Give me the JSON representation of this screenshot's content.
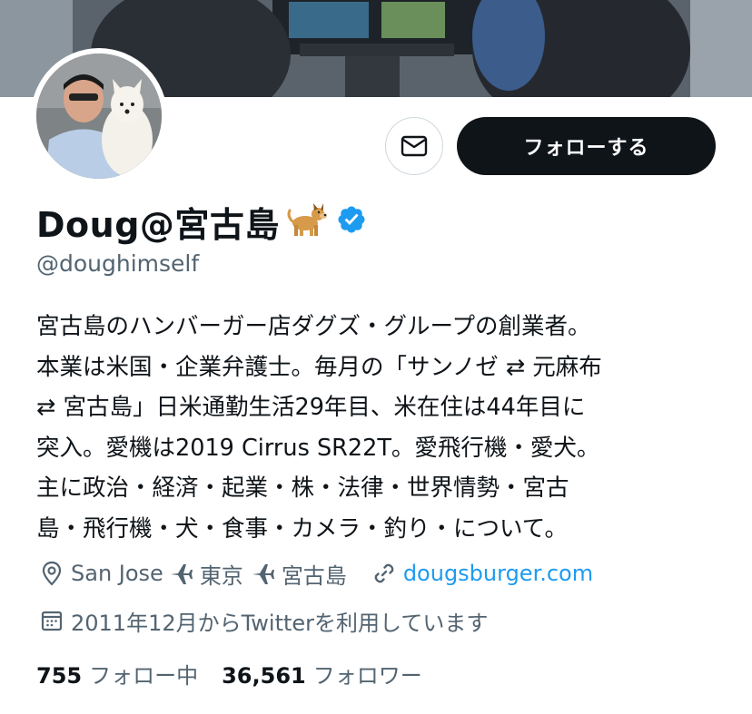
{
  "profile": {
    "display_name": "Doug@宮古島",
    "handle": "@doughimself",
    "bio": "宮古島のハンバーガー店ダグズ・グループの創業者。\n本業は米国・企業弁護士。毎月の「サンノゼ ⇄ 元麻布\n⇄ 宮古島」日米通勤生活29年目、米在住は44年目に\n突入。愛機は2019 Cirrus SR22T。愛飛行機・愛犬。\n主に政治・経済・起業・株・法律・世界情勢・宮古\n島・飛行機・犬・食事・カメラ・釣り・について。",
    "location_parts": [
      "San Jose",
      "東京",
      "宮古島"
    ],
    "url": "dougsburger.com",
    "joined": "2011年12月からTwitterを利用しています",
    "following_count": "755",
    "following_label": "フォロー中",
    "followers_count": "36,561",
    "followers_label": "フォロワー"
  },
  "actions": {
    "follow_label": "フォローする"
  },
  "icons": {
    "message": "mail-icon",
    "verified": "verified-badge-icon",
    "location": "location-pin-icon",
    "plane": "airplane-icon",
    "link": "link-icon",
    "calendar": "calendar-icon",
    "emoji": "dog-emoji"
  },
  "colors": {
    "text": "#0f1419",
    "secondary": "#536471",
    "link": "#1d9bf0",
    "verified": "#1d9bf0",
    "follow_bg": "#0f1419"
  }
}
